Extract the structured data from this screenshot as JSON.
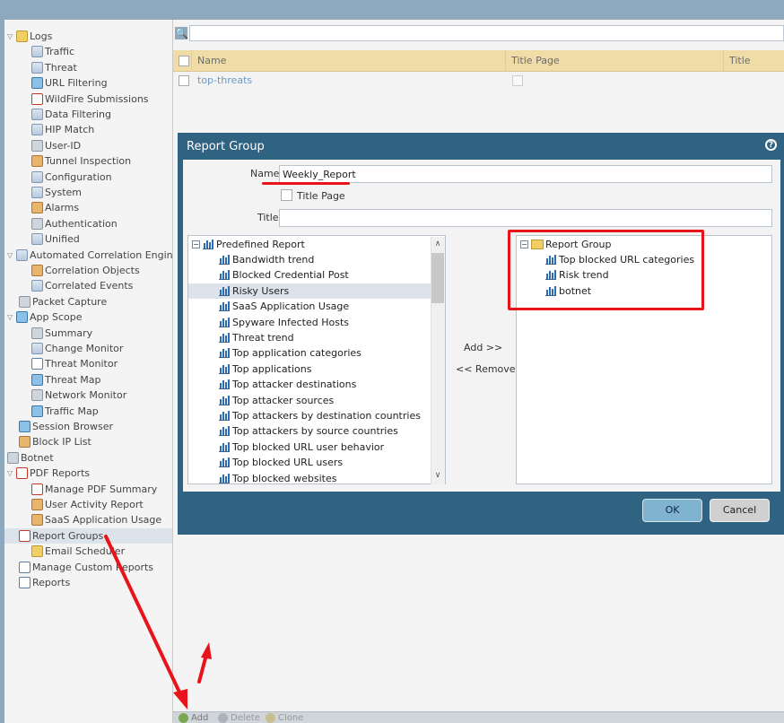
{
  "sidebar": {
    "items": [
      {
        "label": "Logs",
        "icon": "logs-folder-icon",
        "twisty": "▽",
        "expanded": true
      },
      {
        "label": "Traffic",
        "icon": "traffic-log-icon"
      },
      {
        "label": "Threat",
        "icon": "threat-log-icon"
      },
      {
        "label": "URL Filtering",
        "icon": "url-filtering-icon"
      },
      {
        "label": "WildFire Submissions",
        "icon": "wildfire-icon"
      },
      {
        "label": "Data Filtering",
        "icon": "data-filtering-icon"
      },
      {
        "label": "HIP Match",
        "icon": "hip-match-icon"
      },
      {
        "label": "User-ID",
        "icon": "user-id-icon"
      },
      {
        "label": "Tunnel Inspection",
        "icon": "tunnel-inspection-icon"
      },
      {
        "label": "Configuration",
        "icon": "configuration-icon"
      },
      {
        "label": "System",
        "icon": "system-icon"
      },
      {
        "label": "Alarms",
        "icon": "alarms-icon"
      },
      {
        "label": "Authentication",
        "icon": "authentication-icon"
      },
      {
        "label": "Unified",
        "icon": "unified-icon"
      },
      {
        "label": "Automated Correlation Engine",
        "icon": "correlation-engine-icon",
        "twisty": "▽",
        "expanded": true
      },
      {
        "label": "Correlation Objects",
        "icon": "correlation-objects-icon"
      },
      {
        "label": "Correlated Events",
        "icon": "correlated-events-icon"
      },
      {
        "label": "Packet Capture",
        "icon": "packet-capture-icon"
      },
      {
        "label": "App Scope",
        "icon": "app-scope-icon",
        "twisty": "▽",
        "expanded": true
      },
      {
        "label": "Summary",
        "icon": "summary-icon"
      },
      {
        "label": "Change Monitor",
        "icon": "change-monitor-icon"
      },
      {
        "label": "Threat Monitor",
        "icon": "threat-monitor-icon"
      },
      {
        "label": "Threat Map",
        "icon": "threat-map-icon"
      },
      {
        "label": "Network Monitor",
        "icon": "network-monitor-icon"
      },
      {
        "label": "Traffic Map",
        "icon": "traffic-map-icon"
      },
      {
        "label": "Session Browser",
        "icon": "session-browser-icon"
      },
      {
        "label": "Block IP List",
        "icon": "block-ip-list-icon"
      },
      {
        "label": "Botnet",
        "icon": "botnet-icon"
      },
      {
        "label": "PDF Reports",
        "icon": "pdf-reports-icon",
        "twisty": "▽",
        "expanded": true
      },
      {
        "label": "Manage PDF Summary",
        "icon": "manage-pdf-summary-icon"
      },
      {
        "label": "User Activity Report",
        "icon": "user-activity-report-icon"
      },
      {
        "label": "SaaS Application Usage",
        "icon": "saas-application-usage-icon"
      },
      {
        "label": "Report Groups",
        "icon": "report-groups-icon",
        "selected": true
      },
      {
        "label": "Email Scheduler",
        "icon": "email-scheduler-icon"
      },
      {
        "label": "Manage Custom Reports",
        "icon": "manage-custom-reports-icon"
      },
      {
        "label": "Reports",
        "icon": "reports-icon"
      }
    ]
  },
  "grid": {
    "columns": [
      "Name",
      "Title Page",
      "Title"
    ],
    "rows": [
      {
        "name": "top-threats"
      }
    ]
  },
  "dialog": {
    "title": "Report Group",
    "name_label": "Name",
    "name_value": "Weekly_Report",
    "title_page_label": "Title Page",
    "title_page_checked": false,
    "title_label": "Title",
    "title_value": "",
    "add_label": "Add >>",
    "remove_label": "<< Remove",
    "ok_label": "OK",
    "cancel_label": "Cancel",
    "available_root": "Predefined Report",
    "available_items": [
      "Bandwidth trend",
      "Blocked Credential Post",
      "Risky Users",
      "SaaS Application Usage",
      "Spyware Infected Hosts",
      "Threat trend",
      "Top application categories",
      "Top applications",
      "Top attacker destinations",
      "Top attacker sources",
      "Top attackers by destination countries",
      "Top attackers by source countries",
      "Top blocked URL user behavior",
      "Top blocked URL users",
      "Top blocked websites"
    ],
    "selected_available": "Risky Users",
    "group_root": "Report Group",
    "group_items": [
      "Top blocked URL categories",
      "Risk trend",
      "botnet"
    ]
  },
  "bottombar": {
    "add_label": "Add",
    "delete_label": "Delete",
    "clone_label": "Clone"
  },
  "colors": {
    "accent_header": "#306282",
    "annotation_red": "#e8141a",
    "grid_header": "#f0dca6"
  }
}
